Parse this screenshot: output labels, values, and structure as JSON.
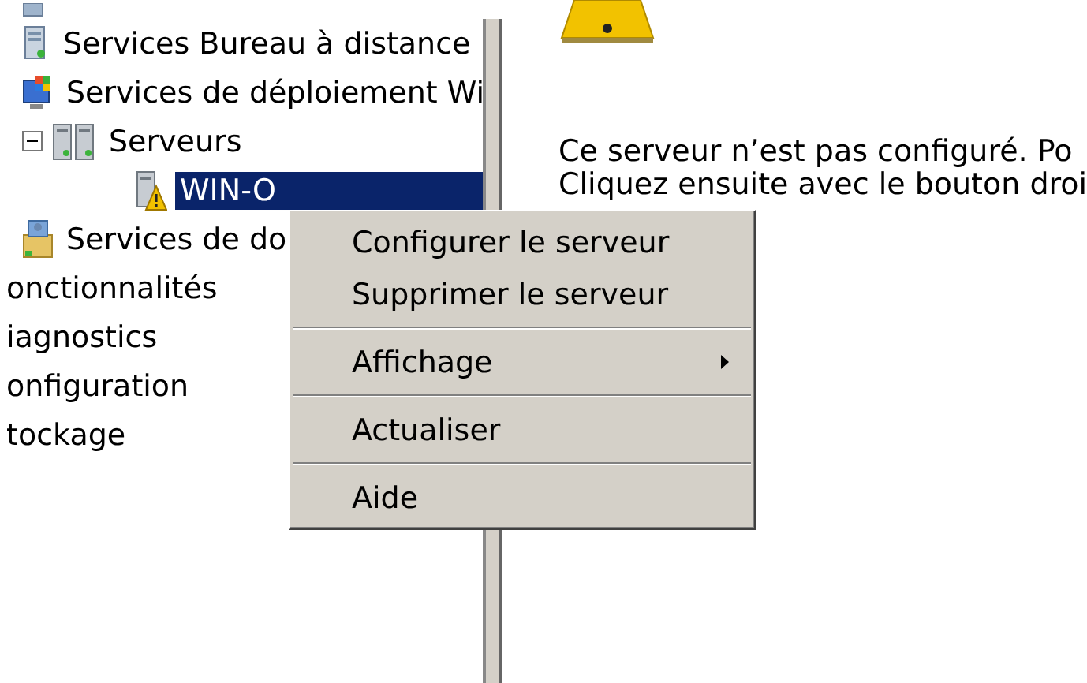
{
  "tree": [
    {
      "kind": "group",
      "children": [
        {
          "label": "Services Bureau à distance",
          "selected": false
        },
        {
          "label": "Services de déploiement Wi",
          "selected": false
        },
        {
          "label": "Serveurs",
          "selected": false,
          "expanded": true,
          "children": [
            {
              "label": "WIN-O",
              "selected": true,
              "warning": true
            }
          ]
        },
        {
          "label": "Services de do",
          "selected": false
        }
      ]
    },
    {
      "kind": "item",
      "label": "onctionnalités",
      "selected": false
    },
    {
      "kind": "item",
      "label": "iagnostics",
      "selected": false
    },
    {
      "kind": "item",
      "label": "onfiguration",
      "selected": false
    },
    {
      "kind": "item",
      "label": "tockage",
      "selected": false
    }
  ],
  "details": {
    "lines": [
      "Ce serveur n’est pas configuré. Po",
      "Cliquez ensuite avec le bouton droi"
    ]
  },
  "context_menu": [
    {
      "kind": "item",
      "label": "Configurer le serveur"
    },
    {
      "kind": "item",
      "label": "Supprimer le serveur"
    },
    {
      "kind": "separator"
    },
    {
      "kind": "item",
      "label": "Affichage",
      "submenu": true
    },
    {
      "kind": "separator"
    },
    {
      "kind": "item",
      "label": "Actualiser"
    },
    {
      "kind": "separator"
    },
    {
      "kind": "item",
      "label": "Aide"
    }
  ]
}
